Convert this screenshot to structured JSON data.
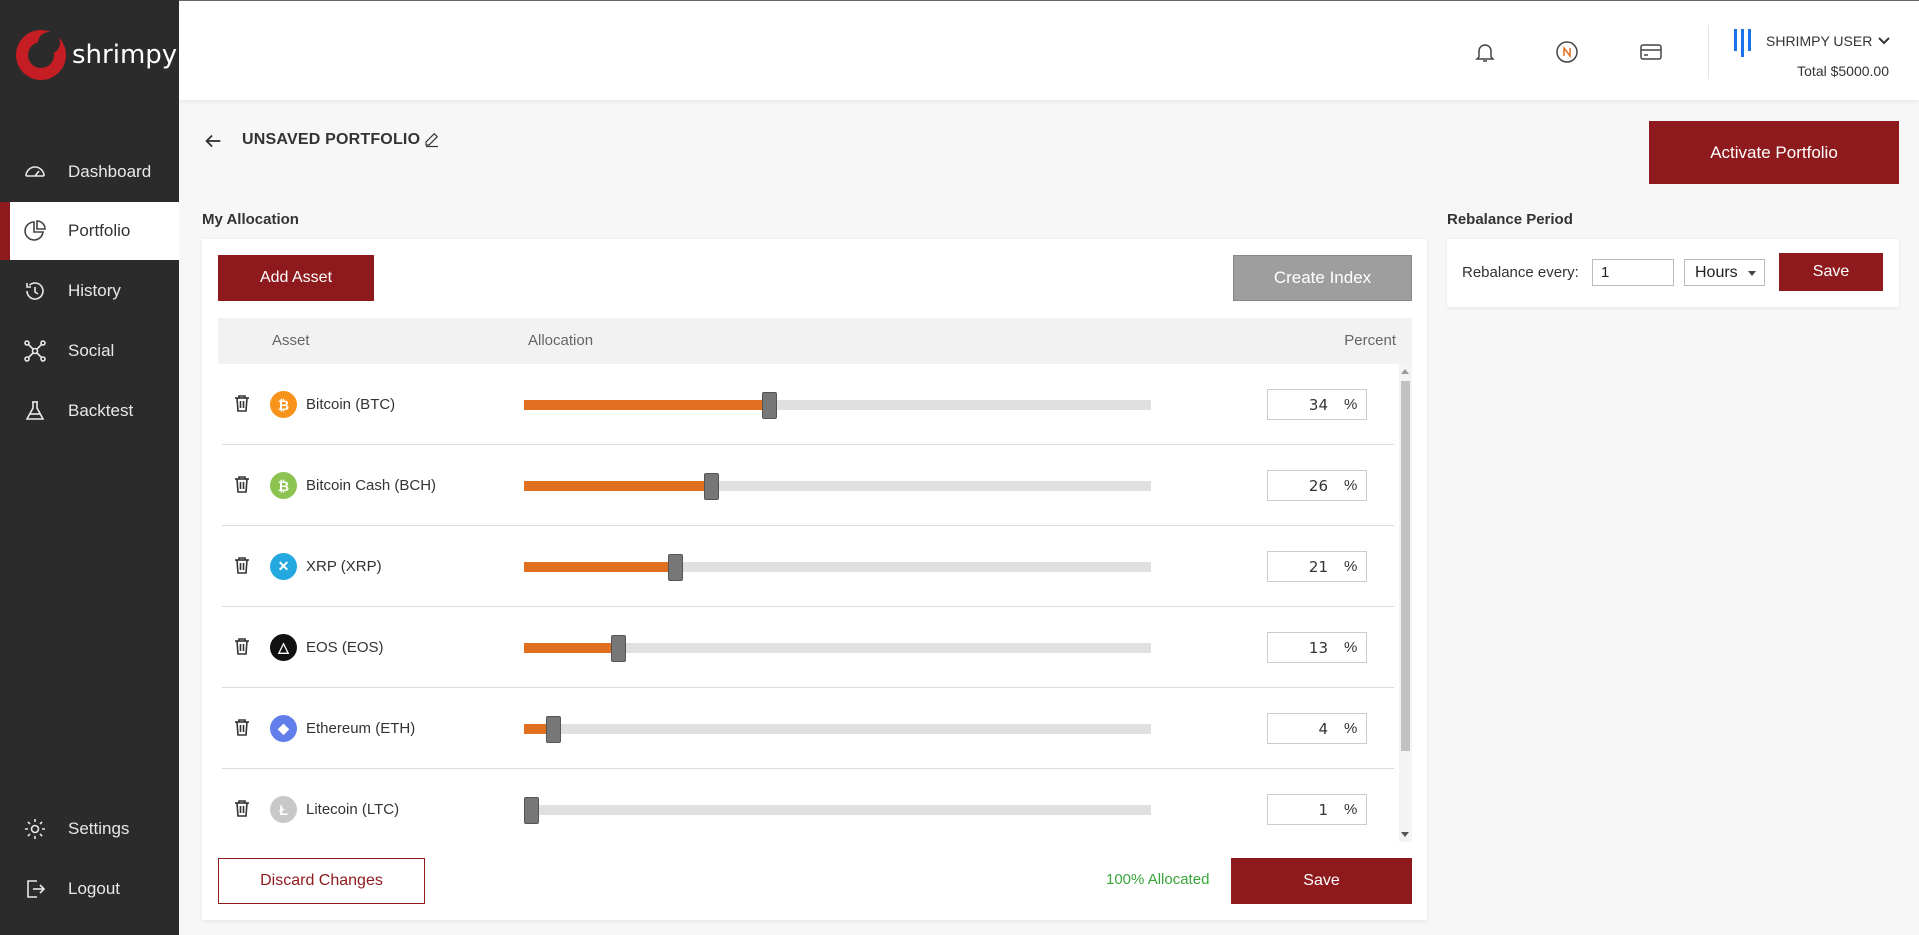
{
  "app": {
    "name": "shrimpy"
  },
  "sidebar": {
    "items": [
      {
        "label": "Dashboard",
        "icon": "gauge-icon"
      },
      {
        "label": "Portfolio",
        "icon": "pie-chart-icon",
        "active": true
      },
      {
        "label": "History",
        "icon": "history-icon"
      },
      {
        "label": "Social",
        "icon": "network-icon"
      },
      {
        "label": "Backtest",
        "icon": "flask-icon"
      }
    ],
    "bottom_items": [
      {
        "label": "Settings",
        "icon": "gear-icon"
      },
      {
        "label": "Logout",
        "icon": "logout-icon"
      }
    ]
  },
  "header": {
    "user_name": "SHRIMPY USER",
    "total": "Total $5000.00",
    "brand_accent": "#1a73e8"
  },
  "page": {
    "title": "UNSAVED PORTFOLIO",
    "activate_button": "Activate Portfolio",
    "my_allocation_label": "My Allocation",
    "rebalance_period_label": "Rebalance Period"
  },
  "allocation": {
    "add_asset_button": "Add Asset",
    "create_index_button": "Create Index",
    "columns": {
      "asset": "Asset",
      "allocation": "Allocation",
      "percent": "Percent"
    },
    "assets": [
      {
        "name": "Bitcoin (BTC)",
        "percent": "34",
        "value": 34,
        "coin_color": "#f7931a",
        "glyph": "₿"
      },
      {
        "name": "Bitcoin Cash (BCH)",
        "percent": "26",
        "value": 26,
        "coin_color": "#8dc351",
        "glyph": "₿"
      },
      {
        "name": "XRP (XRP)",
        "percent": "21",
        "value": 21,
        "coin_color": "#23a9e0",
        "glyph": "✕"
      },
      {
        "name": "EOS (EOS)",
        "percent": "13",
        "value": 13,
        "coin_color": "#111111",
        "glyph": "△"
      },
      {
        "name": "Ethereum (ETH)",
        "percent": "4",
        "value": 4,
        "coin_color": "#627eea",
        "glyph": "◆"
      },
      {
        "name": "Litecoin (LTC)",
        "percent": "1",
        "value": 1,
        "coin_color": "#c8c8c8",
        "glyph": "Ł"
      }
    ],
    "percent_sign": "%",
    "discard_button": "Discard Changes",
    "allocated_status": "100% Allocated",
    "save_button": "Save",
    "slider_color": "#e07020"
  },
  "rebalance": {
    "label": "Rebalance every:",
    "value": "1",
    "unit": "Hours",
    "save_button": "Save"
  },
  "colors": {
    "primary": "#8e1a1d",
    "sidebar_bg": "#2b2b2b",
    "success": "#3aa53a"
  }
}
